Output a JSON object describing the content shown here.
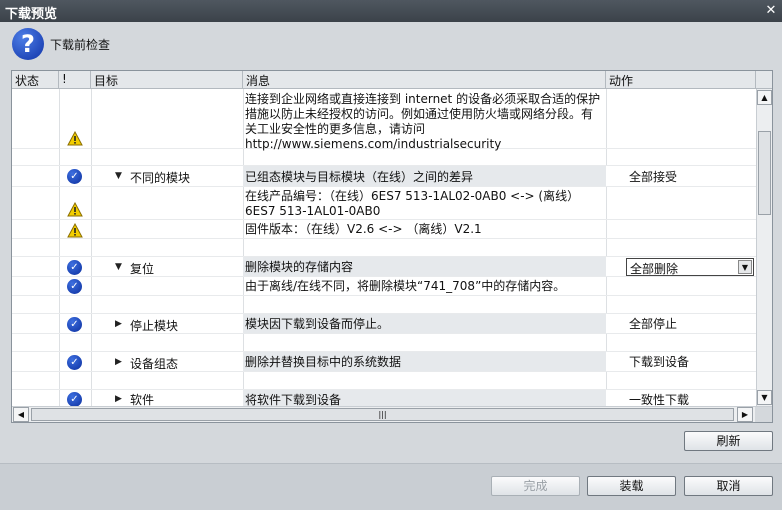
{
  "window": {
    "title": "下载预览",
    "close_glyph": "✕"
  },
  "header": {
    "icon": "question-icon",
    "label": "下载前检查"
  },
  "columns": [
    "状态",
    "!",
    "目标",
    "消息",
    "动作"
  ],
  "rows": [
    {
      "icon": "warning-icon",
      "target": "",
      "message": "连接到企业网络或直接连接到 internet 的设备必须采取合适的保护措施以防止未经授权的访问。例如通过使用防火墙或网络分段。有关工业安全性的更多信息，请访问\nhttp://www.siemens.com/industrialsecurity",
      "action": ""
    },
    {
      "icon": "",
      "target": "",
      "message": "",
      "action": ""
    },
    {
      "icon": "check-icon",
      "toggle": "▼",
      "target": "不同的模块",
      "message": "已组态模块与目标模块（在线）之间的差异",
      "action": "全部接受"
    },
    {
      "icon": "warning-icon",
      "target": "",
      "message": "在线产品编号：（在线）6ES7 513-1AL02-0AB0 <-> (离线）6ES7 513-1AL01-0AB0",
      "action": ""
    },
    {
      "icon": "warning-icon",
      "target": "",
      "message": "固件版本：（在线）V2.6 <-> （离线）V2.1",
      "action": ""
    },
    {
      "icon": "",
      "target": "",
      "message": "",
      "action": ""
    },
    {
      "icon": "check-icon",
      "toggle": "▼",
      "target": "复位",
      "message": "删除模块的存储内容",
      "action": "全部删除",
      "combo": true
    },
    {
      "icon": "check-icon",
      "target": "",
      "message": "由于离线/在线不同，将删除模块“741_708”中的存储内容。",
      "action": ""
    },
    {
      "icon": "",
      "target": "",
      "message": "",
      "action": ""
    },
    {
      "icon": "check-icon",
      "toggle": "▶",
      "target": "停止模块",
      "message": "模块因下载到设备而停止。",
      "action": "全部停止"
    },
    {
      "icon": "",
      "target": "",
      "message": "",
      "action": ""
    },
    {
      "icon": "check-icon",
      "toggle": "▶",
      "target": "设备组态",
      "message": "删除并替换目标中的系统数据",
      "action": "下载到设备"
    },
    {
      "icon": "",
      "target": "",
      "message": "",
      "action": ""
    },
    {
      "icon": "check-icon",
      "toggle": "▶",
      "target": "软件",
      "message": "将软件下载到设备",
      "action": "一致性下载"
    }
  ],
  "buttons": {
    "refresh": "刷新",
    "finish": "完成",
    "load": "装载",
    "cancel": "取消"
  },
  "scrollbars": {
    "up": "▲",
    "down": "▼",
    "left": "◀",
    "right": "▶",
    "thumb_grip": "|||"
  },
  "colors": {
    "titlebar": "#434b53",
    "check": "#1b46c4",
    "warning": "#f2cd00",
    "dialog_bg": "#d4d8dc"
  }
}
